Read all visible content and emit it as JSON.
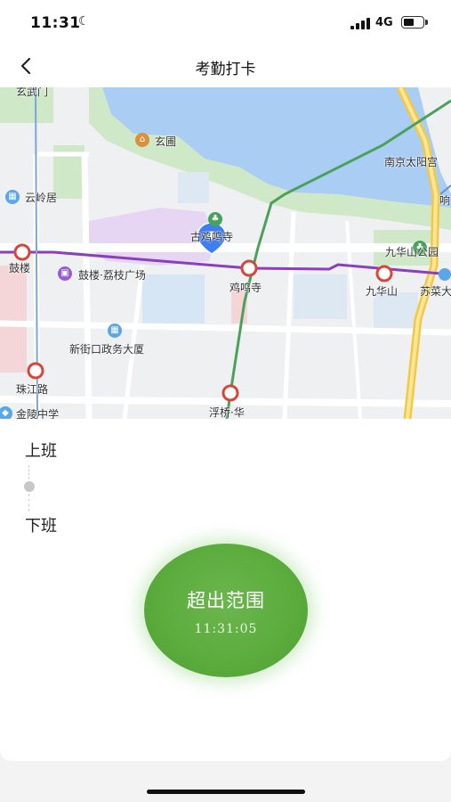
{
  "status_bar": {
    "time": "11:31",
    "network": "4G",
    "battery_level": 0.55
  },
  "nav": {
    "title": "考勤打卡",
    "back_icon": "chevron-left-icon"
  },
  "map": {
    "labels": {
      "xuanwumen": "玄武门",
      "xuanpu": "玄圃",
      "nanjing_taiyanggong": "南京太阳宫",
      "yunling": "云岭居",
      "jiming_temple_poi": "古鸡鸣寺",
      "jiuhuashan_park": "九华山公园",
      "gulou": "鼓楼",
      "gulou_plaza": "鼓楼·荔枝广场",
      "jiming_station": "鸡鸣寺",
      "jiuhuashan_station": "九华山",
      "sucaiyuan": "苏菜大",
      "xinjiekou_gov": "新街口政务大厦",
      "zhujiang_road": "珠江路",
      "fuqiao": "浮桥·华",
      "jinling_school": "金陵中学",
      "xiang": "响"
    },
    "colors": {
      "water": "#a9cdf3",
      "green": "#cfe8c8",
      "metro_purple": "#8a3fbf",
      "metro_green": "#4ba05a",
      "road_yellow": "#f4c842",
      "marker": "#3f7ef0",
      "metro_station": "#d9443b"
    }
  },
  "attendance": {
    "clock_in_label": "上班",
    "clock_out_label": "下班",
    "punch_status": "超出范围",
    "punch_time": "11:31:05",
    "accent": "#5aab3c"
  }
}
